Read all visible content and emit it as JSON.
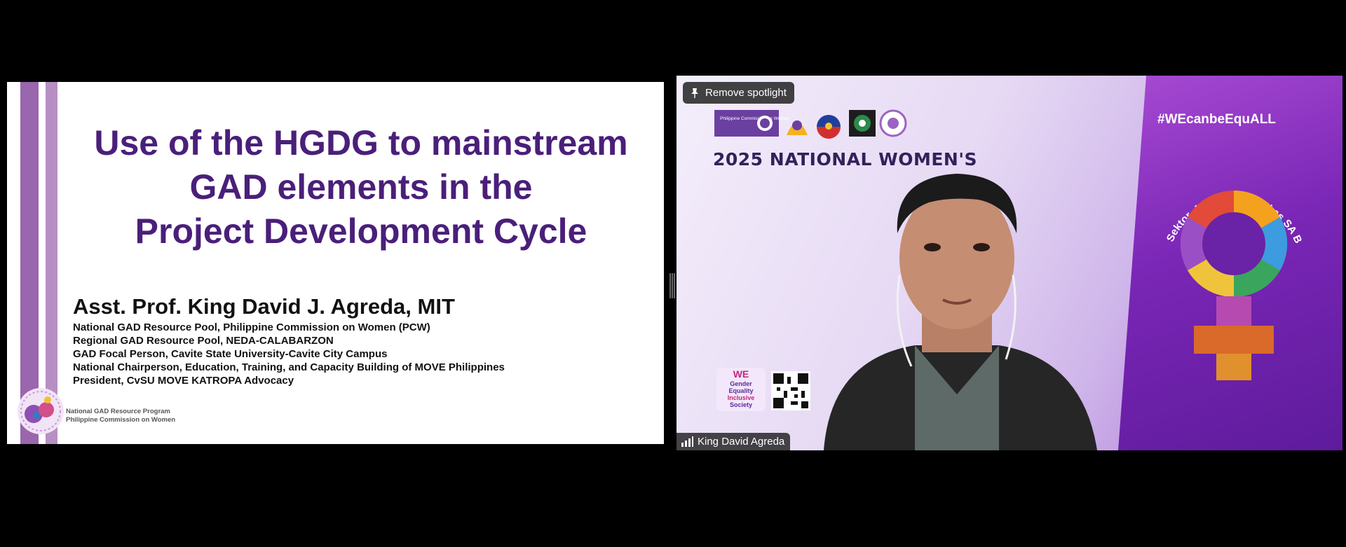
{
  "slide": {
    "title_lines": [
      "Use of the HGDG to mainstream",
      "GAD elements in the",
      "Project Development Cycle"
    ],
    "presenter_name": "Asst. Prof. King David J. Agreda, MIT",
    "credentials": [
      "National GAD Resource Pool, Philippine Commission on Women (PCW)",
      "Regional GAD Resource Pool, NEDA-CALABARZON",
      "GAD Focal Person, Cavite State University-Cavite City Campus",
      "National Chairperson, Education, Training, and Capacity Building of MOVE Philippines",
      "President, CvSU MOVE KATROPA Advocacy"
    ],
    "footer_lines": [
      "National GAD Resource Program",
      "Philippine Commission on Women"
    ]
  },
  "video": {
    "remove_spotlight_label": "Remove spotlight",
    "participant_name": "King David Agreda",
    "background": {
      "event_title": "2025 NATIONAL WOMEN'S",
      "hashtag": "#WEcanbeEquALL",
      "slogan": "Babae sa Lahat ng Sektor, Aangat ang Bukas SA BAGONG PILIPINAS",
      "pcw_logo_text": "Philippine Commission on Women",
      "we_logo_lines": [
        "WE",
        "Gender",
        "Equality",
        "Inclusive",
        "Society"
      ]
    }
  },
  "icons": {
    "spotlight": "pin-icon",
    "signal": "signal-bars-icon"
  },
  "colors": {
    "slide_title": "#4a1f7a",
    "accent_purple": "#9a66ad",
    "tile_purple": "#7a26b6"
  }
}
